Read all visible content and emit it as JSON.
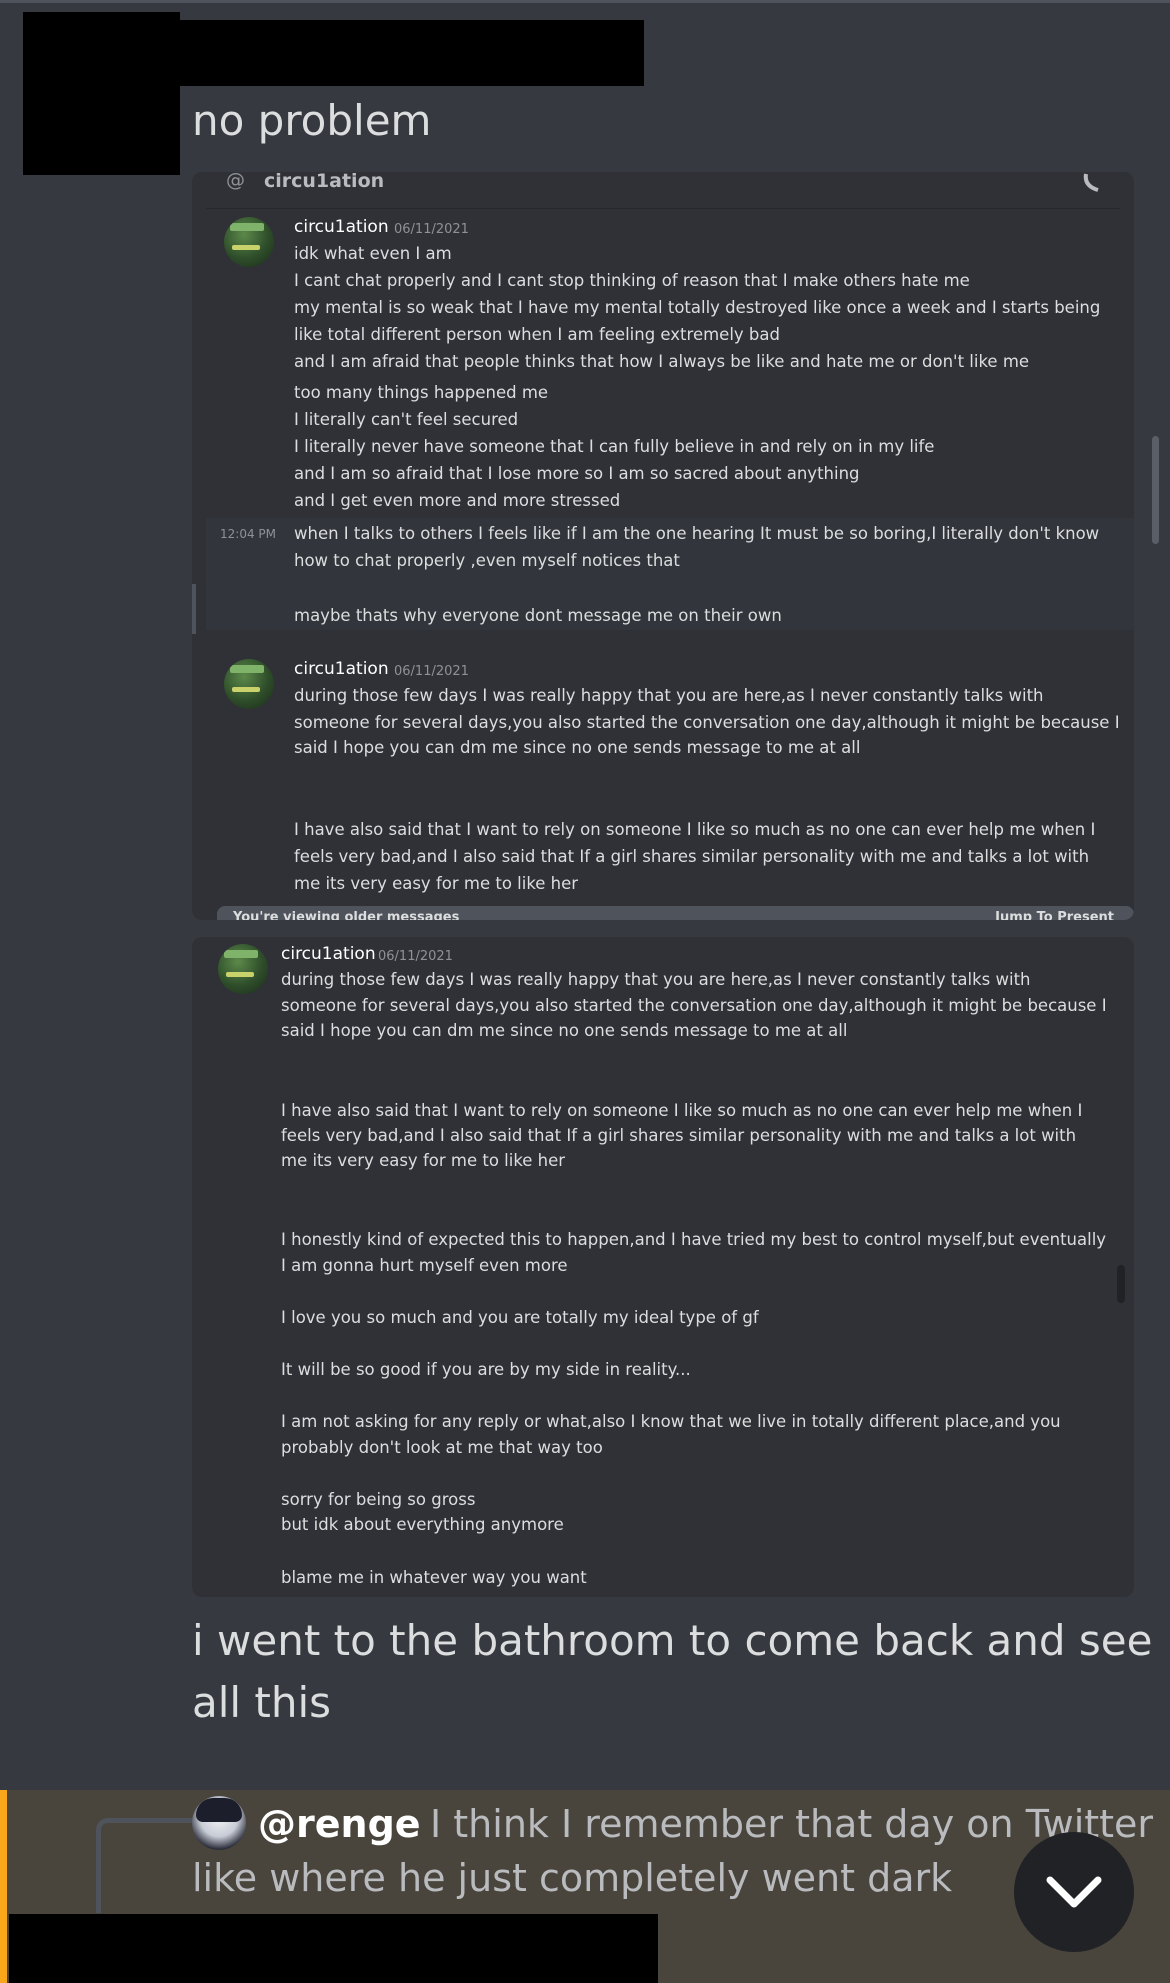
{
  "top_message": {
    "text": "no problem"
  },
  "screenshot1": {
    "header_name": "circu1ation",
    "messages": [
      {
        "username": "circu1ation",
        "date": "06/11/2021",
        "lines": [
          "idk what even I am",
          "I cant chat properly and I cant stop thinking of reason that I make others hate me",
          "my mental is so weak that I have my mental totally destroyed like once a week and I starts being",
          "like total different person when I am feeling extremely bad",
          "and I am afraid that people thinks that how I always be like and hate me or don't like me",
          "too many things happened me",
          "I literally can't feel secured",
          "I literally never have someone that I can fully believe in and rely on in my life",
          "and I am so afraid that I lose more so I am so sacred about anything",
          "and I get even more and more stressed"
        ]
      },
      {
        "time": "12:04 PM",
        "lines": [
          "when I talks to others I feels like if I am the one hearing It must be so boring,I literally don't know",
          "how to chat properly ,even myself notices that",
          "maybe thats why everyone dont message me on their own"
        ]
      },
      {
        "username": "circu1ation",
        "date": "06/11/2021",
        "lines": [
          "during those few days I was really happy that you are here,as I never constantly talks with",
          "someone for several days,you also started the conversation one day,although it might be because I",
          "said I hope you can dm me since no one sends message to me at all",
          "I have also said that I want to rely on someone I like so much as no one can ever help me when I",
          "feels very bad,and I also said that If a girl shares similar personality with me and talks a lot with",
          "me  its very easy for me to like her"
        ]
      }
    ],
    "banner_left": "You're viewing older messages",
    "banner_right": "Jump To Present"
  },
  "screenshot2": {
    "username": "circu1ation",
    "date": "06/11/2021",
    "lines": [
      "during those few days I was really happy that you are here,as I never constantly talks with",
      "someone for several days,you also started the conversation one day,although it might be because I",
      "said I hope you can dm me since no one sends message to me at all",
      "I have also said that I want to rely on someone I like so much as no one can ever help me when I",
      "feels very bad,and I also said that If a girl shares similar personality with me and talks a lot with",
      "me  its very easy for me to like her",
      "I honestly kind of expected this to happen,and I have tried my best to control myself,but eventually",
      "I am gonna hurt myself even more",
      "I love you so much and you are totally my ideal type of gf",
      "It will be so good if you are by my side in reality...",
      "I am not asking for any reply or what,also I know that we live in totally different place,and you",
      "probably don't look at me that way too",
      "sorry for being so gross",
      "but idk about everything anymore",
      "blame me in whatever way you want"
    ]
  },
  "bathroom_message": {
    "line1": "i went to the bathroom to come back and see",
    "line2": "all this"
  },
  "reply": {
    "mention": "@renge",
    "text1": "I think I remember that day on Twitter",
    "text2": "like where he just completely went dark"
  },
  "colors": {
    "background": "#36393f",
    "embed": "#2f3136",
    "accent": "#faa61a",
    "reply_bg": "#49443c"
  },
  "icons": {
    "jump": "chevron-down-icon",
    "call": "phone-icon",
    "at": "at-icon"
  }
}
